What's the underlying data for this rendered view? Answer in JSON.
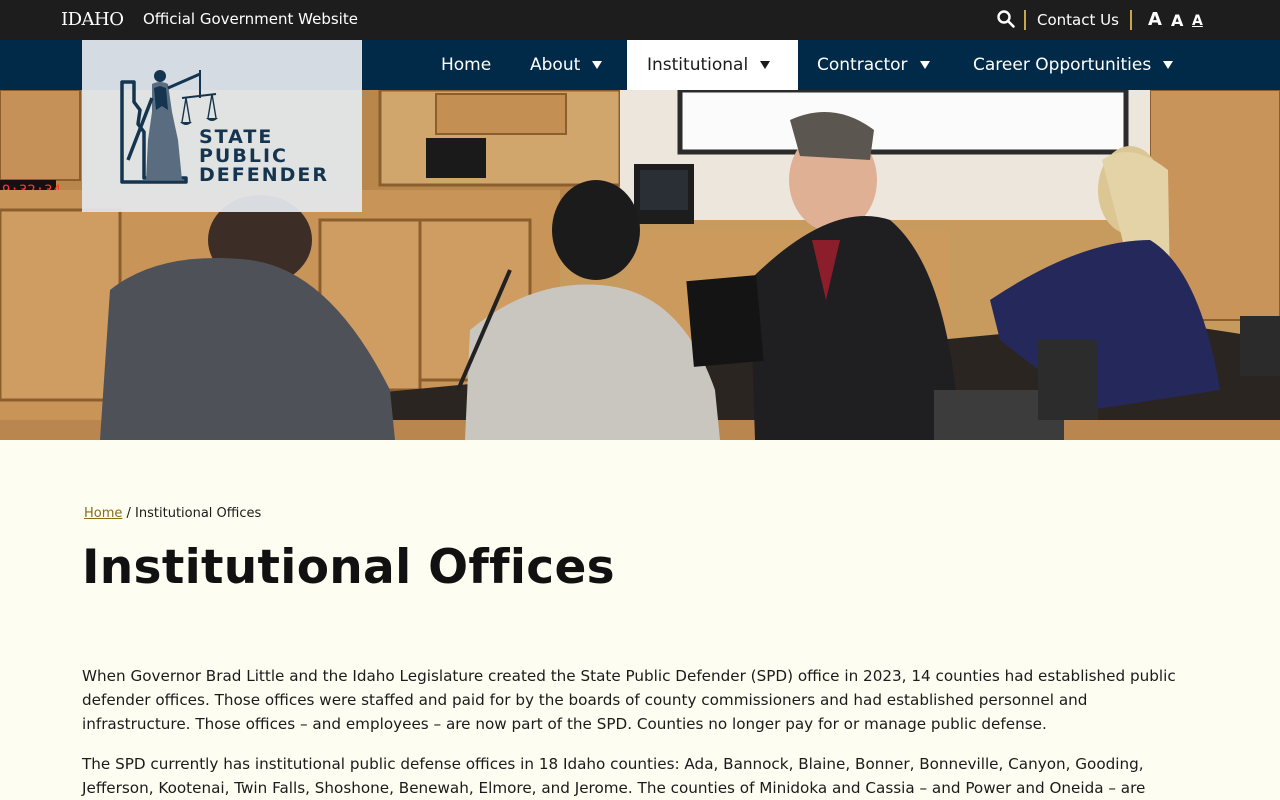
{
  "topbar": {
    "idaho_logo": "IDAHO",
    "gov_label": "Official Government Website",
    "contact_label": "Contact Us",
    "font_sizes": [
      "A",
      "A",
      "A"
    ]
  },
  "nav": {
    "items": [
      {
        "label": "Home",
        "has_menu": false
      },
      {
        "label": "About",
        "has_menu": true
      },
      {
        "label": "Institutional",
        "has_menu": true,
        "active": true
      },
      {
        "label": "Contractor",
        "has_menu": true
      },
      {
        "label": "Career Opportunities",
        "has_menu": true
      }
    ]
  },
  "logo": {
    "line1": "STATE",
    "line2": "PUBLIC",
    "line3": "DEFENDER"
  },
  "hero": {
    "clock_text": "9:32:34"
  },
  "breadcrumb": {
    "home": "Home",
    "separator": "/",
    "current": "Institutional Offices"
  },
  "page": {
    "title": "Institutional Offices",
    "paragraphs": [
      "When Governor Brad Little and the Idaho Legislature created the State Public Defender (SPD) office in 2023, 14 counties had established public defender offices. Those offices were staffed and paid for by the boards of county commissioners and had established personnel and infrastructure. Those offices – and employees – are now part of the SPD. Counties no longer pay for or manage public defense.",
      "The SPD currently has institutional public defense offices in 18 Idaho counties: Ada, Bannock, Blaine, Bonner, Bonneville, Canyon, Gooding, Jefferson, Kootenai, Twin Falls, Shoshone, Benewah, Elmore, and Jerome. The counties of Minidoka and Cassia – and Power and Oneida – are"
    ]
  },
  "colors": {
    "topbar_bg": "#1d1d1d",
    "nav_bg": "#002a48",
    "accent_gold": "#c9a646",
    "page_bg": "#fdfdf2",
    "logo_navy": "#14344f"
  }
}
